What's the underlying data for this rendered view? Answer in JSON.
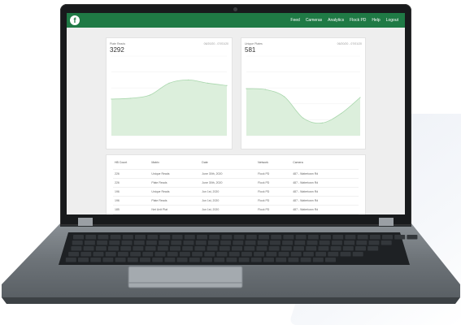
{
  "nav": {
    "logo_letter": "f",
    "items": [
      "Feed",
      "Cameras",
      "Analytics",
      "Flock PD",
      "Help",
      "Logout"
    ]
  },
  "cards": [
    {
      "title": "Plate Reads",
      "value": "3292",
      "range": "06/20/20 - 07/01/20"
    },
    {
      "title": "Unique Plates",
      "value": "581",
      "range": "06/20/20 - 07/01/20"
    }
  ],
  "table": {
    "headers": [
      "HB Count",
      "Matrix",
      "Date",
      "Network",
      "Camera"
    ],
    "rows": [
      [
        "226",
        "Unique Reads",
        "June 30th, 2020",
        "Flock PD",
        "487 - Watertown Rd"
      ],
      [
        "226",
        "Plate Reads",
        "June 30th, 2020",
        "Flock PD",
        "487 - Watertown Rd"
      ],
      [
        "196",
        "Unique Reads",
        "Jun 1st, 2020",
        "Flock PD",
        "487 - Watertown Rd"
      ],
      [
        "196",
        "Plate Reads",
        "Jun 1st, 2020",
        "Flock PD",
        "487 - Watertown Rd"
      ],
      [
        "185",
        "Net Unit Plat",
        "Jun 1st, 2020",
        "Flock PD",
        "487 - Watertown Rd"
      ]
    ]
  },
  "colors": {
    "brand": "#1f7a45",
    "chart_fill": "#dcefdc",
    "chart_line": "#a9d7ad"
  },
  "chart_data": [
    {
      "type": "area",
      "x": [
        "",
        "",
        "",
        "",
        "",
        "",
        ""
      ],
      "values": [
        46,
        47,
        51,
        66,
        70,
        66,
        63
      ],
      "ylim": [
        0,
        100
      ],
      "title": "Plate Reads"
    },
    {
      "type": "area",
      "x": [
        "",
        "",
        "",
        "",
        "",
        "",
        ""
      ],
      "values": [
        59,
        58,
        49,
        22,
        16,
        28,
        48
      ],
      "ylim": [
        0,
        100
      ],
      "title": "Unique Plates"
    }
  ]
}
